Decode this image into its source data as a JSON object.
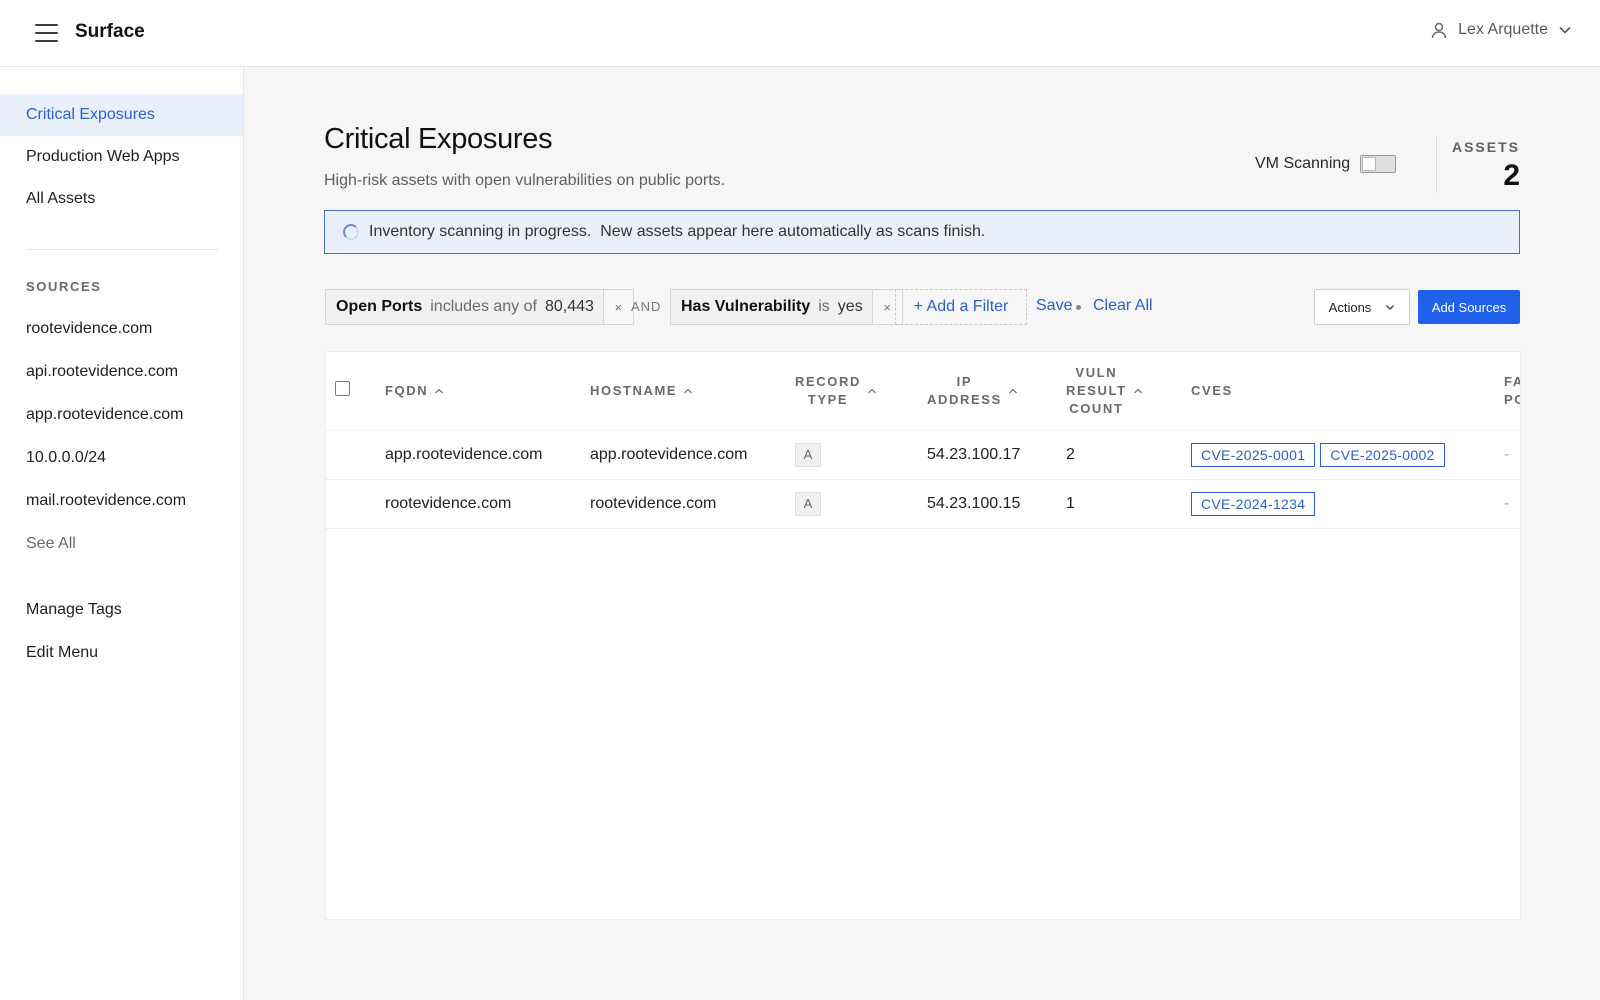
{
  "app": {
    "name": "Surface",
    "user": "Lex Arquette"
  },
  "sidebar": {
    "views": [
      {
        "label": "Critical Exposures",
        "active": true
      },
      {
        "label": "Production Web Apps",
        "active": false
      },
      {
        "label": "All Assets",
        "active": false
      }
    ],
    "sources_heading": "SOURCES",
    "sources": [
      "rootevidence.com",
      "api.rootevidence.com",
      "app.rootevidence.com",
      "10.0.0.0/24",
      "mail.rootevidence.com"
    ],
    "see_all": "See All",
    "manage_tags": "Manage Tags",
    "edit_menu": "Edit Menu"
  },
  "page": {
    "title": "Critical Exposures",
    "subtitle": "High-risk assets with open vulnerabilities on public ports.",
    "vm_scanning_label": "VM Scanning",
    "vm_scanning_on": false,
    "assets_label": "ASSETS",
    "assets_count": "2",
    "banner": "Inventory scanning in progress.  New assets appear here automatically as scans finish."
  },
  "filters": [
    {
      "name": "Open Ports",
      "op": "includes any of",
      "value": "80,443",
      "remove": "×"
    },
    {
      "name": "Has Vulnerability",
      "op": "is",
      "value": "yes",
      "remove": "×"
    }
  ],
  "filter_joiner": "AND",
  "toolbar": {
    "add_filter": "+ Add a Filter",
    "save": "Save",
    "clear_all": "Clear All",
    "actions": "Actions",
    "add_sources": "Add Sources"
  },
  "table": {
    "columns": [
      "FQDN",
      "HOSTNAME",
      "RECORD\nTYPE",
      "IP\nADDRESS",
      "VULN\nRESULT\nCOUNT",
      "CVES",
      "FA\nPO"
    ],
    "rows": [
      {
        "fqdn": "app.rootevidence.com",
        "hostname": "app.rootevidence.com",
        "record_type": "A",
        "ip": "54.23.100.17",
        "vuln_count": "2",
        "cves": [
          "CVE-2025-0001",
          "CVE-2025-0002"
        ],
        "extra": "-"
      },
      {
        "fqdn": "rootevidence.com",
        "hostname": "rootevidence.com",
        "record_type": "A",
        "ip": "54.23.100.15",
        "vuln_count": "1",
        "cves": [
          "CVE-2024-1234"
        ],
        "extra": "-"
      }
    ]
  },
  "colors": {
    "accent": "#2c5fd1",
    "primary_button": "#2160e8",
    "active_nav_bg": "#eaf0fb",
    "banner_border": "#4a6fd0"
  }
}
